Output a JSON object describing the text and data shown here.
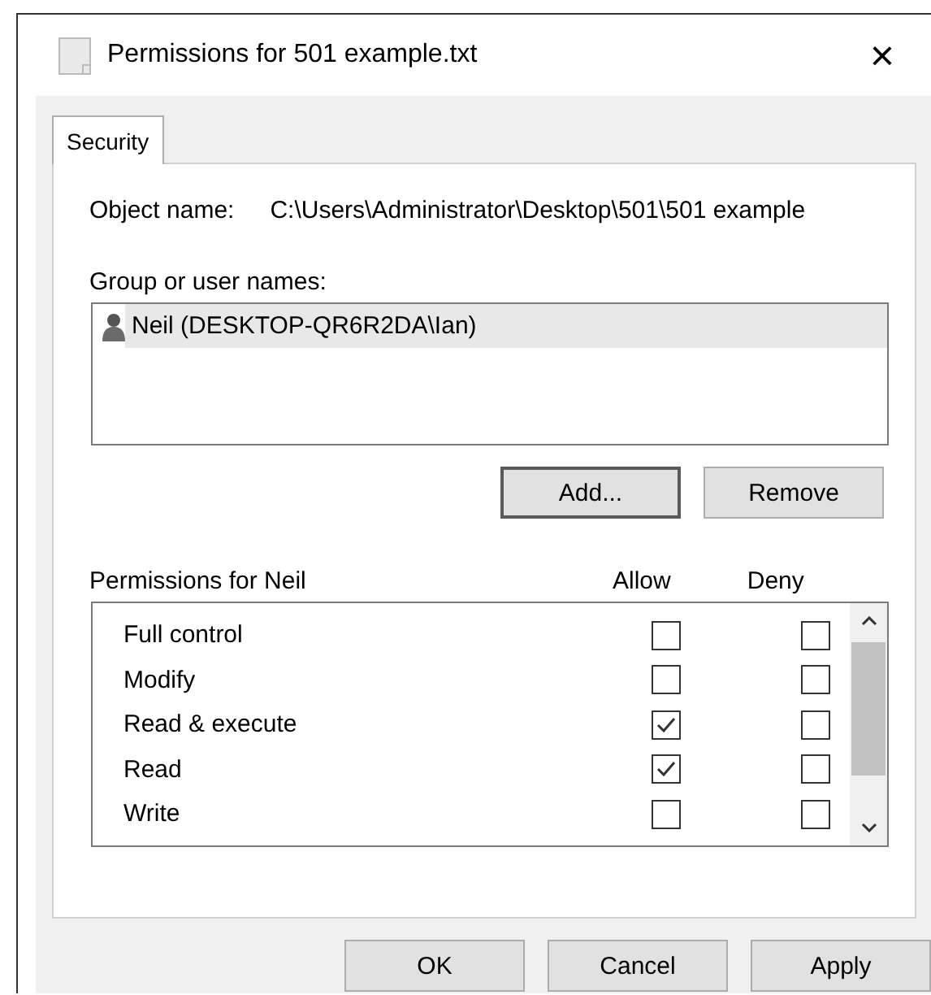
{
  "window": {
    "title": "Permissions for 501 example.txt",
    "close": "×"
  },
  "tabs": [
    {
      "label": "Security",
      "selected": true
    }
  ],
  "object_name": {
    "label": "Object name:",
    "value": "C:\\Users\\Administrator\\Desktop\\501\\501 example"
  },
  "group_label": "Group or user names:",
  "users": [
    {
      "name": "Neil (DESKTOP-QR6R2DA\\Ian)",
      "selected": true
    }
  ],
  "user_buttons": [
    {
      "label": "Add...",
      "default": true
    },
    {
      "label": "Remove",
      "default": false
    }
  ],
  "permissions_header": {
    "label": "Permissions for Neil",
    "allow": "Allow",
    "deny": "Deny"
  },
  "permissions": [
    {
      "name": "Full control",
      "allow": false,
      "deny": false
    },
    {
      "name": "Modify",
      "allow": false,
      "deny": false
    },
    {
      "name": "Read & execute",
      "allow": true,
      "deny": false
    },
    {
      "name": "Read",
      "allow": true,
      "deny": false
    },
    {
      "name": "Write",
      "allow": false,
      "deny": false
    }
  ],
  "buttons": [
    {
      "label": "OK"
    },
    {
      "label": "Cancel"
    },
    {
      "label": "Apply"
    }
  ]
}
